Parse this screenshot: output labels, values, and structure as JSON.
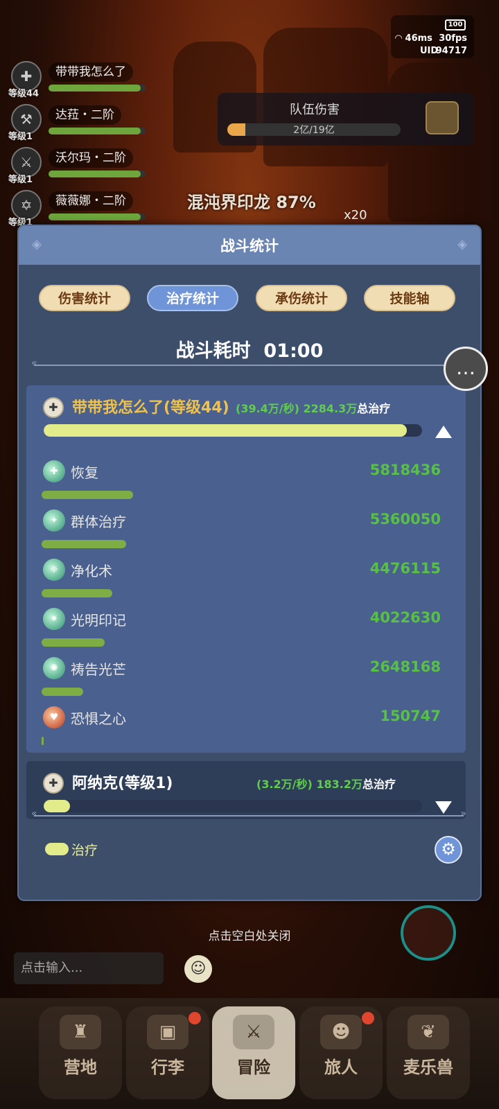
{
  "status": {
    "battery": "100",
    "ping": "46ms",
    "fps": "30fps",
    "uid_label": "UID",
    "uid_value": "94717"
  },
  "party": [
    {
      "name": "带带我怎么了",
      "level": "等级44",
      "hp": 0.95
    },
    {
      "name": "达菈・二阶",
      "level": "等级1",
      "hp": 0.95
    },
    {
      "name": "沃尔玛・二阶",
      "level": "等级1",
      "hp": 0.95
    },
    {
      "name": "薇薇娜・二阶",
      "level": "等级1",
      "hp": 0.95
    }
  ],
  "team_damage": {
    "title": "队伍伤害",
    "value": "2亿/19亿",
    "progress": 0.105
  },
  "boss": {
    "name": "混沌界印龙",
    "percent": "87%",
    "multiplier": "x20"
  },
  "panel": {
    "title": "战斗统计",
    "tabs": [
      {
        "label": "伤害统计",
        "active": false
      },
      {
        "label": "治疗统计",
        "active": true
      },
      {
        "label": "承伤统计",
        "active": false
      },
      {
        "label": "技能轴",
        "active": false
      }
    ],
    "duration_label": "战斗耗时",
    "duration_value": "01:00",
    "players": [
      {
        "name": "带带我怎么了(等级44)",
        "rate": "(39.4万/秒)",
        "total": "2284.3万",
        "total_label": "总治疗",
        "share": 0.96,
        "expanded": true,
        "skills": [
          {
            "name": "恢复",
            "value": "5818436",
            "icon": "heal-icon"
          },
          {
            "name": "群体治疗",
            "value": "5360050",
            "icon": "group-heal-icon"
          },
          {
            "name": "净化术",
            "value": "4476115",
            "icon": "purify-icon"
          },
          {
            "name": "光明印记",
            "value": "4022630",
            "icon": "light-mark-icon"
          },
          {
            "name": "祷告光芒",
            "value": "2648168",
            "icon": "prayer-icon"
          },
          {
            "name": "恐惧之心",
            "value": "150747",
            "icon": "fear-heart-icon"
          }
        ]
      },
      {
        "name": "阿纳克(等级1)",
        "rate": "(3.2万/秒)",
        "total": "183.2万",
        "total_label": "总治疗",
        "share": 0.07,
        "expanded": false
      }
    ],
    "legend": "治疗"
  },
  "close_hint": "点击空白处关闭",
  "chat_placeholder": "点击输入...",
  "nav": [
    {
      "label": "营地",
      "active": false,
      "badge": false
    },
    {
      "label": "行李",
      "active": false,
      "badge": true
    },
    {
      "label": "冒险",
      "active": true,
      "badge": false
    },
    {
      "label": "旅人",
      "active": false,
      "badge": true
    },
    {
      "label": "麦乐兽",
      "active": false,
      "badge": false
    }
  ],
  "colors": {
    "panel_bg": "#3d4e6a",
    "header_bg": "#6b85b2",
    "heal_bar": "#e3ec8a",
    "heal_text": "#56c143",
    "name_gold": "#f0c24a",
    "active_tab": "#6f94d8"
  }
}
